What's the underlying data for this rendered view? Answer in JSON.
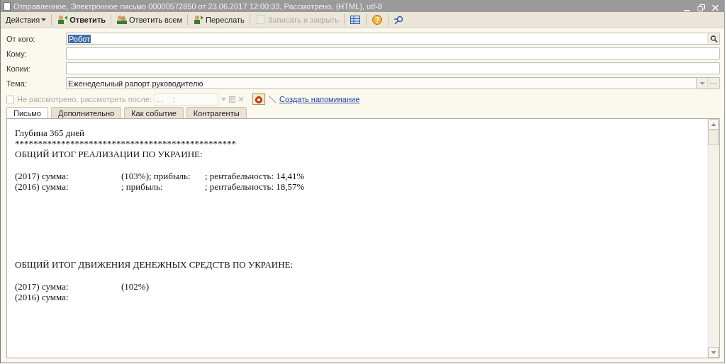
{
  "window": {
    "title": "Отправленное, Электронное письмо 00000572850 от 23.06.2017 12:00:33, Рассмотрено,  (HTML), utf-8"
  },
  "toolbar": [
    {
      "kind": "menu",
      "label": "Действия",
      "disabled": false
    },
    {
      "kind": "reply",
      "label": "Ответить",
      "bold": true,
      "disabled": false
    },
    {
      "kind": "reply-all",
      "label": "Ответить всем",
      "bold": false,
      "disabled": false
    },
    {
      "kind": "forward",
      "label": "Переслать",
      "bold": false,
      "disabled": false
    },
    {
      "kind": "save",
      "label": "Записать и закрыть",
      "bold": false,
      "disabled": true
    },
    {
      "kind": "table",
      "disabled": false
    },
    {
      "kind": "help",
      "disabled": false
    },
    {
      "kind": "find",
      "disabled": false
    }
  ],
  "fields": [
    {
      "kind": "lookup",
      "label": "От кого:",
      "value": "Робот",
      "selected": true
    },
    {
      "kind": "plain",
      "label": "Кому:"
    },
    {
      "kind": "plain",
      "label": "Копии:"
    },
    {
      "kind": "combo",
      "label": "Тема:",
      "value": "Еженедельный рапорт руководителю"
    }
  ],
  "review": {
    "label": "Не рассмотрено, рассмотреть после:",
    "checked": false,
    "date_mask": " . .     :  ",
    "link": "Создать напоминание"
  },
  "tabs": [
    {
      "label": "Письмо",
      "selected": true
    },
    {
      "label": "Дополнительно",
      "selected": false
    },
    {
      "label": "Как событие",
      "selected": false
    },
    {
      "label": "Контрагенты",
      "selected": false
    }
  ],
  "letter": [
    {
      "lines": [
        [
          "Глубина 365 дней"
        ],
        [
          "************************************************"
        ],
        [
          "ОБЩИЙ ИТОГ РЕАЛИЗАЦИИ ПО УКРАИНЕ:"
        ]
      ]
    },
    {
      "lines": [
        [
          "(2017) сумма:",
          "(103%); прибыль:",
          "; рентабельность: 14,41%"
        ],
        [
          "(2016) сумма:",
          "; прибыль:",
          "; рентабельность: 18,57%"
        ]
      ]
    },
    {
      "lines": [
        [
          "ОБЩИЙ ИТОГ ДВИЖЕНИЯ ДЕНЕЖНЫХ СРЕДСТВ ПО УКРАИНЕ:"
        ]
      ]
    },
    {
      "lines": [
        [
          "(2017) сумма:",
          "(102%)"
        ],
        [
          "(2016) сумма:"
        ]
      ]
    }
  ]
}
